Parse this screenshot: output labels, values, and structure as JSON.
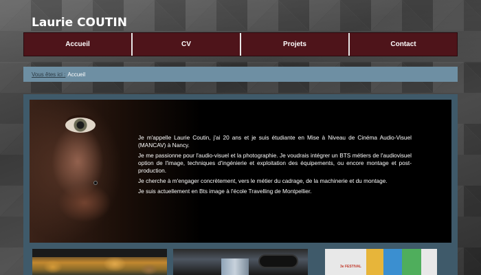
{
  "site": {
    "title": "Laurie COUTIN"
  },
  "nav": {
    "items": [
      {
        "label": "Accueil"
      },
      {
        "label": "CV"
      },
      {
        "label": "Projets"
      },
      {
        "label": "Contact"
      }
    ]
  },
  "breadcrumb": {
    "prefix": "Vous êtes ici :",
    "current": "Accueil"
  },
  "hero": {
    "paragraphs": [
      "Je m'appelle Laurie Coutin, j'ai 20 ans et je suis étudiante en Mise à Niveau de Cinéma Audio-Visuel (MANCAV) à Nancy.",
      "Je me passionne pour l'audio-visuel et la photographie. Je voudrais intégrer un BTS métiers de l'audiovisuel option de l'image, techniques d'ingénierie et exploitation des équipements, ou encore montage et post-production.",
      "Je cherche à m'engager concrètement, vers le métier du cadrage, de la machinerie et du montage.",
      "Je suis actuellement en Bts image à l'école Travelling de Montpellier."
    ]
  },
  "thumbnails": {
    "poster_text": "3e FESTIVAL"
  },
  "colors": {
    "nav_bg": "#4e141a",
    "breadcrumb_bg": "#6e8fa3",
    "panel_bg": "#3f5a6a"
  }
}
